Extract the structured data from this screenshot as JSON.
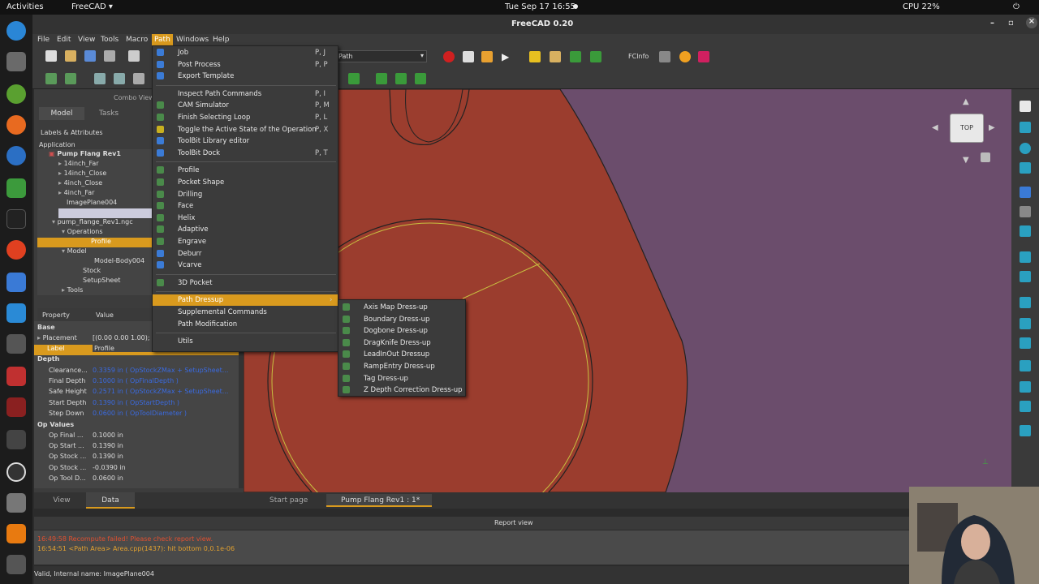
{
  "topbar": {
    "activities": "Activities",
    "app": "FreeCAD ▾",
    "datetime": "Tue Sep 17  16:55",
    "cpu": "CPU 22%"
  },
  "window": {
    "title": "FreeCAD 0.20"
  },
  "menubar": [
    "File",
    "Edit",
    "View",
    "Tools",
    "Macro",
    "Path",
    "Windows",
    "Help"
  ],
  "toolbar": {
    "workbench": "Path",
    "fcinfo": "FCInfo"
  },
  "combo_view": {
    "title": "Combo View",
    "tabs": [
      "Model",
      "Tasks"
    ],
    "section": "Labels & Attributes",
    "application": "Application"
  },
  "tree": [
    {
      "label": "Pump Flang Rev1",
      "bold": true
    },
    {
      "label": "14inch_Far"
    },
    {
      "label": "14inch_Close"
    },
    {
      "label": "4inch_Close"
    },
    {
      "label": "4inch_Far"
    },
    {
      "label": "ImagePlane004"
    },
    {
      "label": ""
    },
    {
      "label": "pump_flange_Rev1.ngc"
    },
    {
      "label": "Operations"
    },
    {
      "label": "Profile",
      "selected": true
    },
    {
      "label": "Model"
    },
    {
      "label": "Model-Body004"
    },
    {
      "label": "Stock"
    },
    {
      "label": "SetupSheet"
    },
    {
      "label": "Tools"
    }
  ],
  "properties": {
    "headers": [
      "Property",
      "Value"
    ],
    "rows": [
      {
        "group": "Base"
      },
      {
        "name": "Placement",
        "value": "[(0.00 0.00 1.00);"
      },
      {
        "name": "Label",
        "value": "Profile",
        "selected": true
      },
      {
        "group": "Depth"
      },
      {
        "name": "Clearance...",
        "value": "0.3359 in   ( OpStockZMax + SetupSheet...",
        "expr": true
      },
      {
        "name": "Final Depth",
        "value": "0.1000 in   ( OpFinalDepth )",
        "expr": true
      },
      {
        "name": "Safe Height",
        "value": "0.2571 in   ( OpStockZMax + SetupSheet...",
        "expr": true
      },
      {
        "name": "Start Depth",
        "value": "0.1390 in   ( OpStartDepth )",
        "expr": true
      },
      {
        "name": "Step Down",
        "value": "0.0600 in   ( OpToolDiameter )",
        "expr": true
      },
      {
        "group": "Op Values"
      },
      {
        "name": "Op Final ...",
        "value": "0.1000 in"
      },
      {
        "name": "Op Start ...",
        "value": "0.1390 in"
      },
      {
        "name": "Op Stock ...",
        "value": "0.1390 in"
      },
      {
        "name": "Op Stock ...",
        "value": "-0.0390 in"
      },
      {
        "name": "Op Tool D...",
        "value": "0.0600 in"
      }
    ],
    "bottom_tabs": [
      "View",
      "Data"
    ]
  },
  "path_menu": {
    "items": [
      {
        "label": "Job",
        "shortcut": "P, J",
        "color": "#3b7bd6"
      },
      {
        "label": "Post Process",
        "shortcut": "P, P",
        "color": "#3b7bd6"
      },
      {
        "label": "Export Template",
        "shortcut": "",
        "color": "#3b7bd6"
      },
      {
        "sep": true
      },
      {
        "label": "Inspect Path Commands",
        "shortcut": "P, I",
        "color": ""
      },
      {
        "label": "CAM Simulator",
        "shortcut": "P, M",
        "color": "#4a8a4a"
      },
      {
        "label": "Finish Selecting Loop",
        "shortcut": "P, L",
        "color": "#4a8a4a"
      },
      {
        "label": "Toggle the Active State of the Operation",
        "shortcut": "P, X",
        "color": "#c8b020"
      },
      {
        "label": "ToolBit Library editor",
        "shortcut": "",
        "color": "#3b7bd6"
      },
      {
        "label": "ToolBit Dock",
        "shortcut": "P, T",
        "color": "#3b7bd6"
      },
      {
        "sep": true
      },
      {
        "label": "Profile",
        "shortcut": "",
        "color": "#4a8a4a"
      },
      {
        "label": "Pocket Shape",
        "shortcut": "",
        "color": "#4a8a4a"
      },
      {
        "label": "Drilling",
        "shortcut": "",
        "color": "#4a8a4a"
      },
      {
        "label": "Face",
        "shortcut": "",
        "color": "#4a8a4a"
      },
      {
        "label": "Helix",
        "shortcut": "",
        "color": "#4a8a4a"
      },
      {
        "label": "Adaptive",
        "shortcut": "",
        "color": "#4a8a4a"
      },
      {
        "label": "Engrave",
        "shortcut": "",
        "color": "#4a8a4a"
      },
      {
        "label": "Deburr",
        "shortcut": "",
        "color": "#3b7bd6"
      },
      {
        "label": "Vcarve",
        "shortcut": "",
        "color": "#3b7bd6"
      },
      {
        "sep": true
      },
      {
        "label": "3D Pocket",
        "shortcut": "",
        "color": "#4a8a4a"
      },
      {
        "sep": true
      },
      {
        "label": "Path Dressup",
        "shortcut": "",
        "color": "",
        "selected": true,
        "submenu": true
      },
      {
        "label": "Supplemental Commands",
        "shortcut": "",
        "color": ""
      },
      {
        "label": "Path Modification",
        "shortcut": "",
        "color": ""
      },
      {
        "sep": true
      },
      {
        "label": "Utils",
        "shortcut": "",
        "color": ""
      }
    ]
  },
  "dressup_menu": {
    "items": [
      "Axis Map Dress-up",
      "Boundary Dress-up",
      "Dogbone Dress-up",
      "DragKnife Dress-up",
      "LeadInOut Dressup",
      "RampEntry Dress-up",
      "Tag Dress-up",
      "Z Depth Correction Dress-up"
    ]
  },
  "navcube": {
    "face": "TOP"
  },
  "doc_tabs": [
    "Start page",
    "Pump Flang Rev1 : 1*"
  ],
  "report": {
    "title": "Report view",
    "lines": [
      {
        "text": "16:49:58  Recompute failed! Please check report view.",
        "color": "#e05030"
      },
      {
        "text": "16:54:51  <Path Area> Area.cpp(1437): hit bottom 0,0.1e-06",
        "color": "#e0a030"
      }
    ]
  },
  "status": "Valid, Internal name: ImagePlane004",
  "colors": {
    "accent": "#d99a1e",
    "viewport": "#6b5070",
    "part": "#9b3d2e"
  }
}
